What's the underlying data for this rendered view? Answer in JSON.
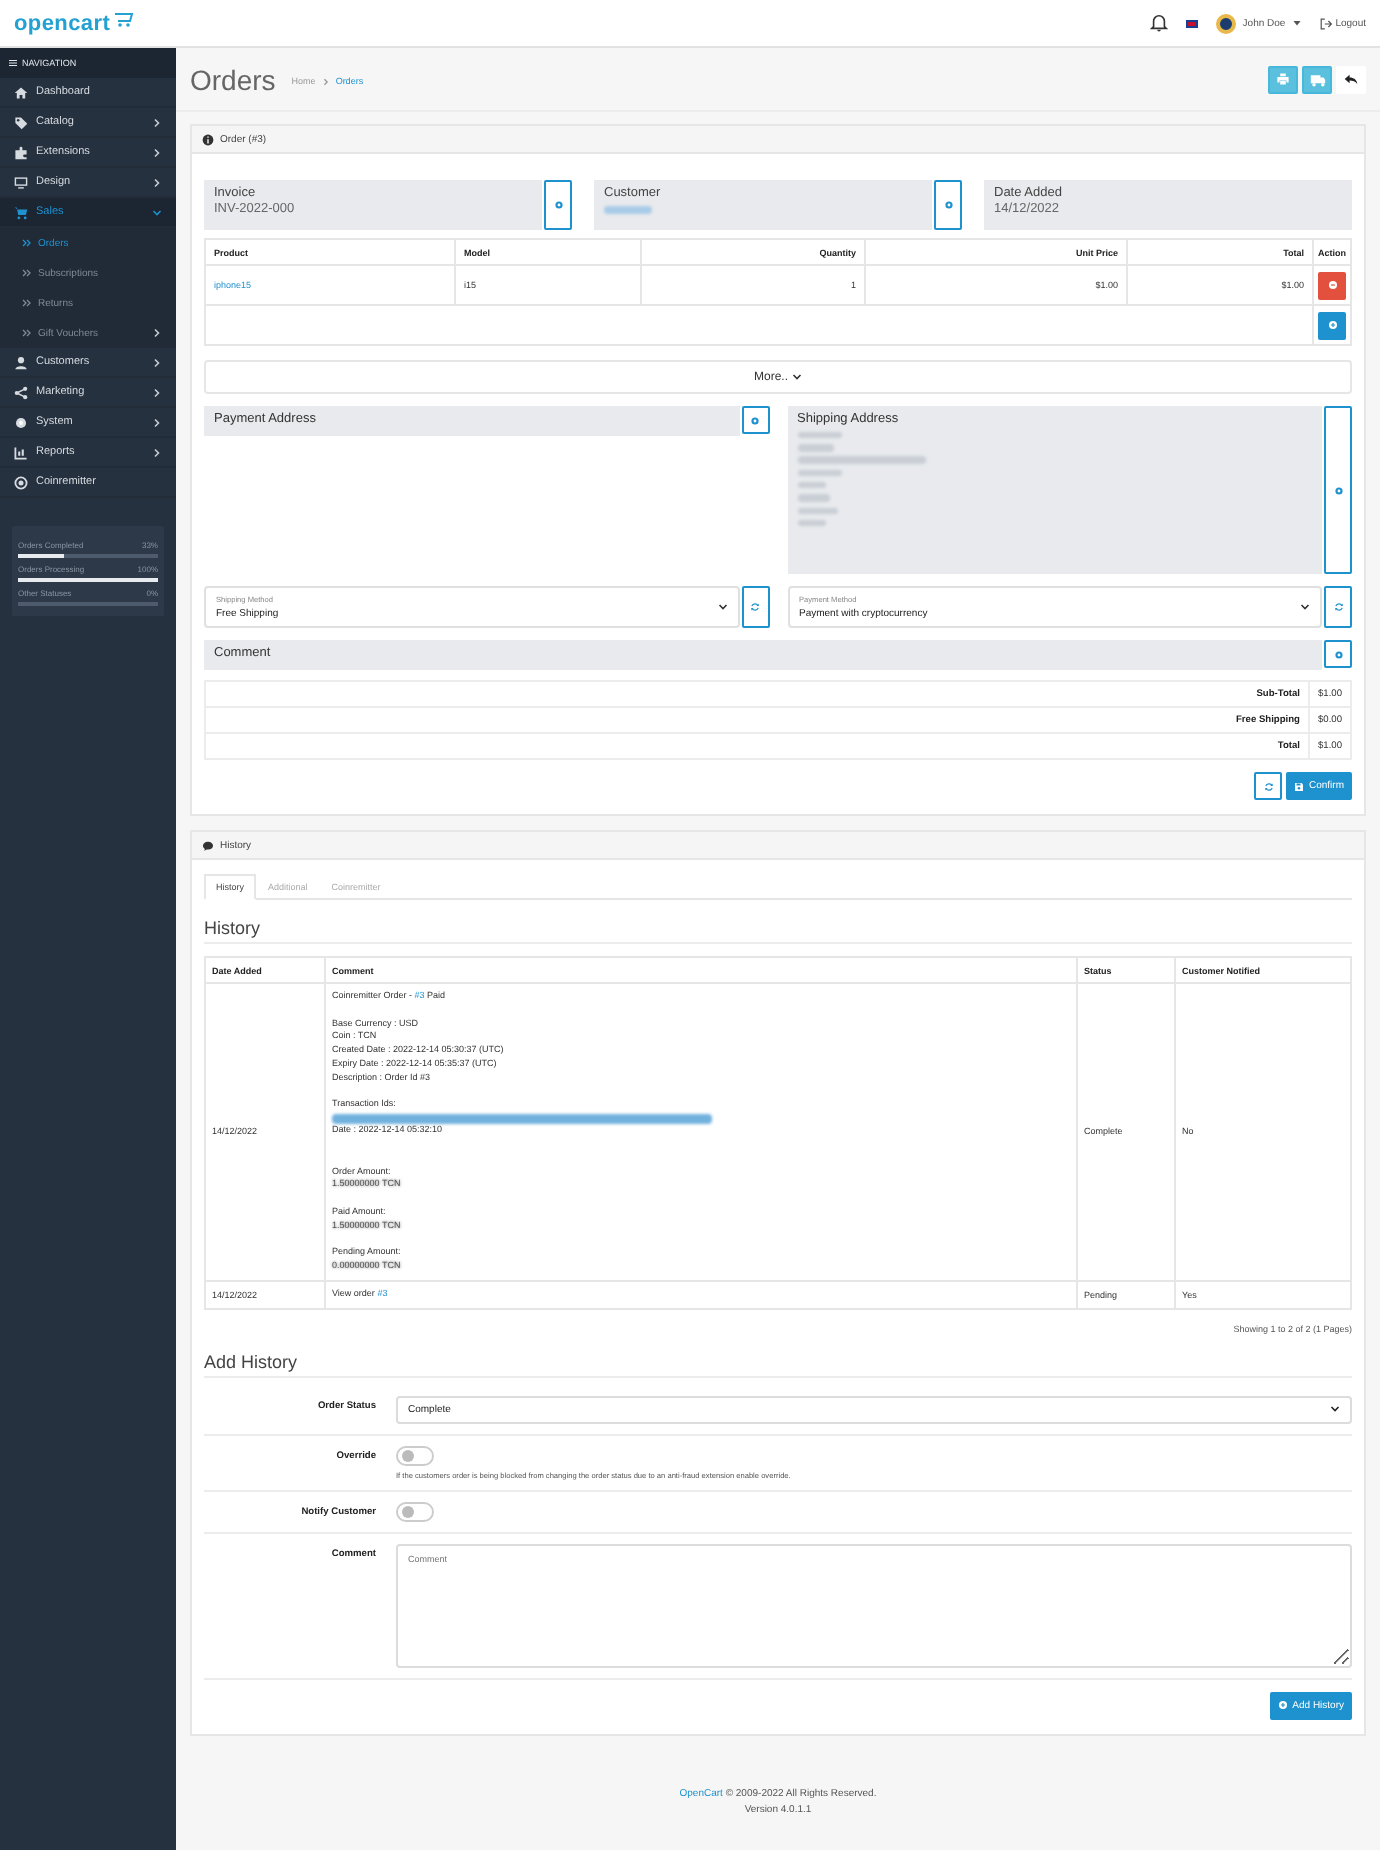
{
  "header": {
    "logo": "opencart",
    "user": "John Doe",
    "logout": "Logout"
  },
  "sidebar": {
    "heading": "NAVIGATION",
    "items": [
      {
        "label": "Dashboard",
        "selected": false
      },
      {
        "label": "Catalog",
        "selected": false,
        "expanded": false
      },
      {
        "label": "Extensions",
        "selected": false,
        "expanded": false
      },
      {
        "label": "Design",
        "selected": false,
        "expanded": false
      },
      {
        "label": "Sales",
        "selected": true,
        "expanded": true,
        "children": [
          {
            "label": "Orders",
            "selected": true
          },
          {
            "label": "Subscriptions",
            "selected": false
          },
          {
            "label": "Returns",
            "selected": false
          },
          {
            "label": "Gift Vouchers",
            "selected": false,
            "expanded": false
          }
        ]
      },
      {
        "label": "Customers",
        "selected": false,
        "expanded": false
      },
      {
        "label": "Marketing",
        "selected": false,
        "expanded": false
      },
      {
        "label": "System",
        "selected": false,
        "expanded": false
      },
      {
        "label": "Reports",
        "selected": false,
        "expanded": false
      },
      {
        "label": "Coinremitter",
        "selected": false
      }
    ],
    "stats": [
      {
        "label": "Orders Completed",
        "reading": "33%",
        "level": 0.33
      },
      {
        "label": "Orders Processing",
        "reading": "100%",
        "level": 1
      },
      {
        "label": "Other Statuses",
        "reading": "0%",
        "level": 0
      }
    ]
  },
  "page": {
    "title": "Orders",
    "breadcrumb": [
      {
        "label": "Home",
        "selected": false
      },
      {
        "label": "Orders",
        "selected": true
      }
    ]
  },
  "order": {
    "title": "Order (#3)",
    "info": [
      {
        "label": "Invoice",
        "kind": "text",
        "value": "INV-2022-000",
        "editable": true
      },
      {
        "label": "Customer",
        "kind": "redacted",
        "editable": true
      },
      {
        "label": "Date Added",
        "kind": "text",
        "value": "14/12/2022",
        "editable": false
      }
    ],
    "products": {
      "columns": [
        "Product",
        "Model",
        "Quantity",
        "Unit Price",
        "Total",
        "Action"
      ],
      "rows": [
        {
          "product": "iphone15",
          "model": "i15",
          "quantity": "1",
          "unit_price": "$1.00",
          "total": "$1.00"
        }
      ]
    },
    "more": "More..",
    "payment_address": {
      "title": "Payment Address"
    },
    "shipping_address": {
      "title": "Shipping Address",
      "lines": [
        {
          "kind": "redacted"
        },
        {
          "kind": "redacted"
        },
        {
          "kind": "redacted"
        },
        {
          "kind": "redacted"
        },
        {
          "kind": "redacted"
        },
        {
          "kind": "redacted"
        },
        {
          "kind": "redacted"
        },
        {
          "kind": "redacted"
        }
      ]
    },
    "shipping_method": {
      "label": "Shipping Method",
      "value": "Free Shipping"
    },
    "payment_method": {
      "label": "Payment Method",
      "value": "Payment with cryptocurrency"
    },
    "comment": "Comment",
    "totals": [
      {
        "label": "Sub-Total",
        "value": "$1.00"
      },
      {
        "label": "Free Shipping",
        "value": "$0.00"
      },
      {
        "label": "Total",
        "value": "$1.00"
      }
    ],
    "confirm": "Confirm"
  },
  "history": {
    "title": "History",
    "tabs": [
      {
        "label": "History",
        "selected": true
      },
      {
        "label": "Additional",
        "selected": false
      },
      {
        "label": "Coinremitter",
        "selected": false
      }
    ],
    "section_title": "History",
    "columns": [
      "Date Added",
      "Comment",
      "Status",
      "Customer Notified"
    ],
    "rows": [
      {
        "date": "14/12/2022",
        "status": "Complete",
        "notified": "No",
        "comment": [
          {
            "kind": "link",
            "before": "Coinremitter Order - ",
            "link": "#3",
            "after": " Paid"
          },
          {
            "kind": "gap"
          },
          {
            "kind": "text",
            "text": "Base Currency : USD"
          },
          {
            "kind": "text",
            "text": "Coin : TCN"
          },
          {
            "kind": "text",
            "text": "Created Date : 2022-12-14 05:30:37 (UTC)"
          },
          {
            "kind": "text",
            "text": "Expiry Date : 2022-12-14 05:35:37 (UTC)"
          },
          {
            "kind": "text",
            "text": "Description : Order Id #3"
          },
          {
            "kind": "gap"
          },
          {
            "kind": "text",
            "text": "Transaction Ids:"
          },
          {
            "kind": "redacted"
          },
          {
            "kind": "text",
            "text": "Date : 2022-12-14 05:32:10"
          },
          {
            "kind": "gap"
          },
          {
            "kind": "gap"
          },
          {
            "kind": "text",
            "text": "Order Amount:"
          },
          {
            "kind": "amount",
            "text": "1.50000000 TCN"
          },
          {
            "kind": "gap"
          },
          {
            "kind": "text",
            "text": "Paid Amount:"
          },
          {
            "kind": "amount",
            "text": "1.50000000 TCN"
          },
          {
            "kind": "gap"
          },
          {
            "kind": "text",
            "text": "Pending Amount:"
          },
          {
            "kind": "amount",
            "text": "0.00000000 TCN"
          }
        ]
      },
      {
        "date": "14/12/2022",
        "status": "Pending",
        "notified": "Yes",
        "comment": [
          {
            "kind": "link",
            "before": "View order ",
            "link": "#3"
          }
        ]
      }
    ],
    "pagination": "Showing 1 to 2 of 2 (1 Pages)",
    "add_title": "Add History",
    "order_status": {
      "label": "Order Status",
      "value": "Complete"
    },
    "override": {
      "label": "Override",
      "on": false,
      "help": "If the customers order is being blocked from changing the order status due to an anti-fraud extension enable override."
    },
    "notify": {
      "label": "Notify Customer",
      "on": false
    },
    "comment": {
      "label": "Comment",
      "placeholder": "Comment"
    },
    "add_button": "Add History"
  },
  "footer": {
    "link": "OpenCart",
    "text": " © 2009-2022 All Rights Reserved.",
    "version": "Version 4.0.1.1"
  }
}
